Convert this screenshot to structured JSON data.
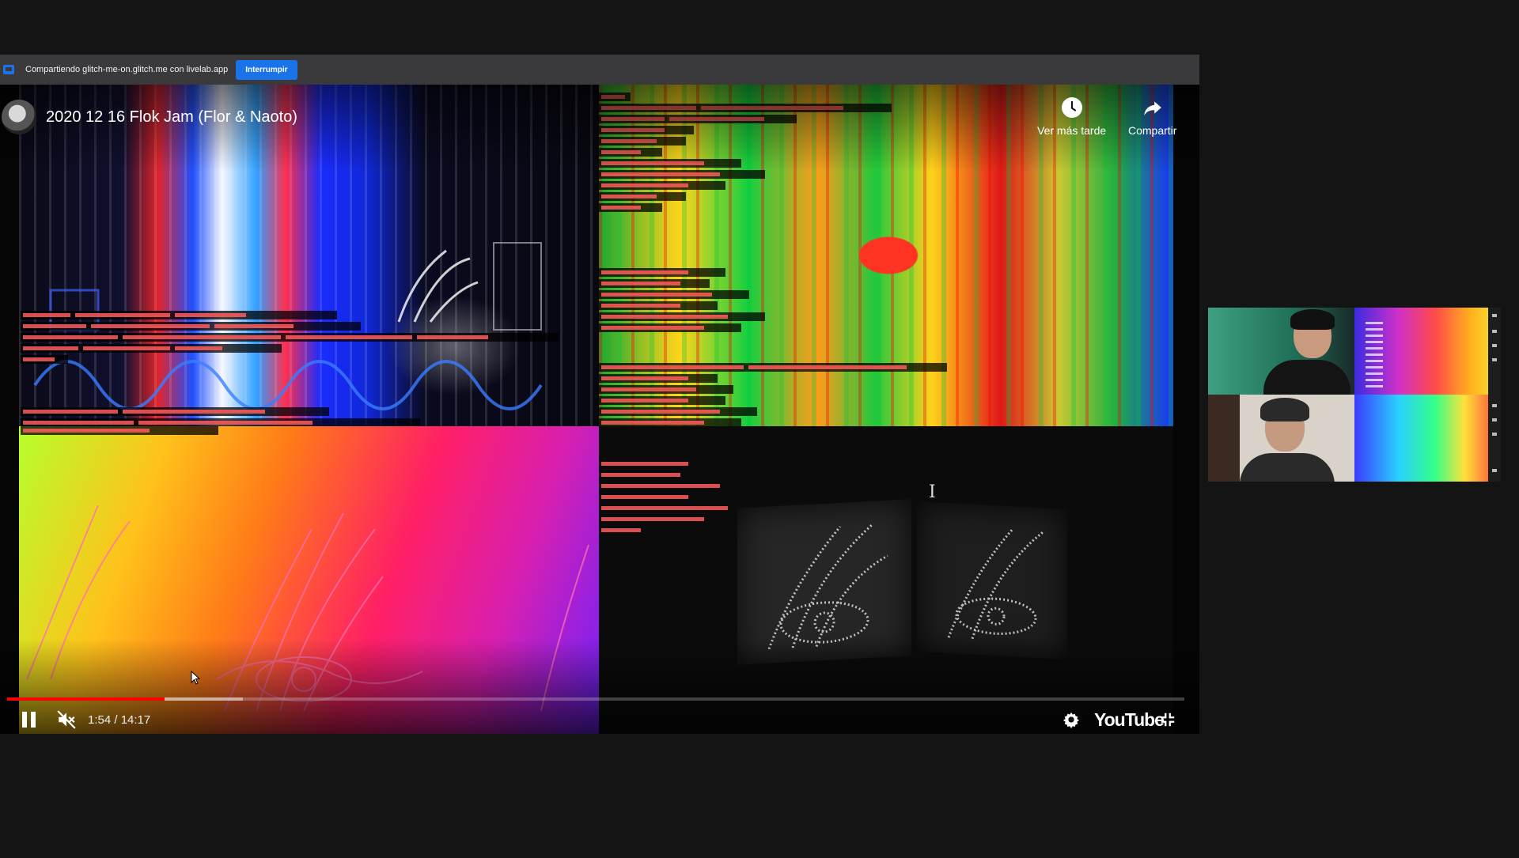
{
  "share_bar": {
    "message": "Compartiendo glitch-me-on.glitch.me con livelab.app",
    "stop_label": "Interrumpir",
    "icon": "screen-share-icon",
    "accent_color": "#1a73e8"
  },
  "player": {
    "title": "2020 12 16 Flok Jam (Flor & Naoto)",
    "watch_later_label": "Ver más tarde",
    "share_label": "Compartir",
    "time_display": "1:54 / 14:17",
    "progress_played_fraction": 0.134,
    "progress_buffered_fraction": 0.2,
    "progress_color": "#ff0000",
    "brand_label": "YouTube",
    "icons": [
      "pause-icon",
      "volume-muted-icon",
      "settings-icon",
      "exit-fullscreen-icon",
      "clock-icon",
      "share-arrow-icon"
    ]
  },
  "call": {
    "participants": [
      "participant-1",
      "participant-2"
    ]
  }
}
